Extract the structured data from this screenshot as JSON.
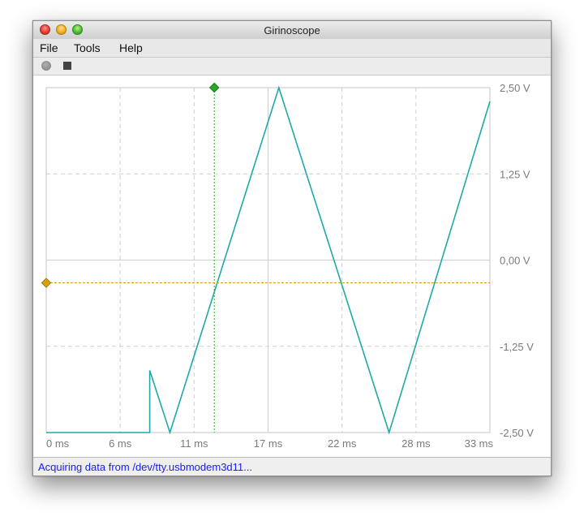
{
  "window": {
    "title": "Girinoscope"
  },
  "menu": {
    "file": "File",
    "tools": "Tools",
    "help": "Help"
  },
  "toolbar": {
    "record_icon": "record-icon",
    "stop_icon": "stop-icon"
  },
  "status": {
    "text": "Acquiring data from /dev/tty.usbmodem3d11..."
  },
  "colors": {
    "signal": "#1fa9a7",
    "trigger_time": "#22aa22",
    "trigger_level": "#d4a20a",
    "grid": "#cfcfcf",
    "status_text": "#1a1aff"
  },
  "chart_data": {
    "type": "line",
    "title": "",
    "xlabel": "",
    "ylabel": "",
    "x_ticks": [
      "0 ms",
      "6 ms",
      "11 ms",
      "17 ms",
      "22 ms",
      "28 ms",
      "33 ms"
    ],
    "y_ticks": [
      "2,50 V",
      "1,25 V",
      "0,00 V",
      "-1,25 V",
      "-2,50 V"
    ],
    "xlim": [
      0,
      33
    ],
    "ylim": [
      -2.5,
      2.5
    ],
    "grid": true,
    "trigger_time_ms": 12.5,
    "trigger_level_v": -0.33,
    "series": [
      {
        "x": [
          0,
          7.7,
          7.7,
          9.2,
          17.3,
          25.5,
          33.0
        ],
        "y": [
          -2.5,
          -2.5,
          -1.6,
          -2.5,
          2.5,
          -2.5,
          2.3
        ]
      }
    ]
  }
}
